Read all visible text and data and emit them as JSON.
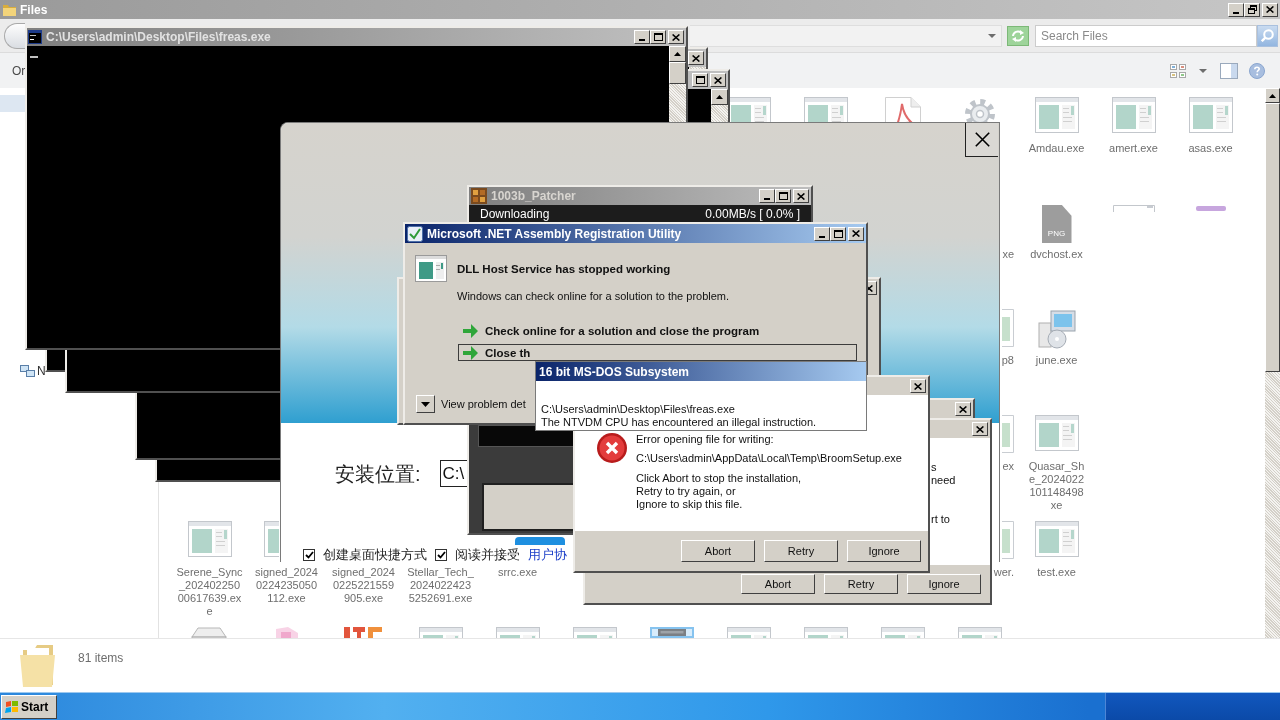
{
  "explorer": {
    "title": "Files",
    "search": {
      "placeholder": "Search Files"
    },
    "command_bar": {
      "organize": "Or"
    },
    "nav_items": [
      {
        "selected": true
      },
      {
        "label": "N",
        "selected": false
      }
    ],
    "files": [
      {
        "kind": "doc",
        "selected": false
      },
      {
        "kind": "doc",
        "selected": false
      },
      {
        "kind": "pdf",
        "selected": false
      },
      {
        "kind": "gear",
        "selected": false
      },
      {
        "kind": "doc",
        "label": "Amdau.exe",
        "selected": false
      },
      {
        "kind": "doc",
        "label": "amert.exe",
        "selected": false
      },
      {
        "kind": "doc",
        "label": "asas.exe",
        "selected": false
      },
      {
        "kind": "tail",
        "label": "xe",
        "selected": false
      },
      {
        "kind": "png",
        "badge": "PNG",
        "label": "dvchost.ex",
        "selected": false
      },
      {
        "kind": "sliver",
        "selected": false
      },
      {
        "kind": "band",
        "selected": false
      },
      {
        "kind": "edge",
        "label": "p8",
        "selected": false
      },
      {
        "kind": "setup",
        "label": "june.exe",
        "selected": false
      },
      {
        "kind": "edge",
        "label": "ex",
        "selected": false
      },
      {
        "kind": "doc",
        "lines": [
          "Quasar_Sh",
          "e_2024022",
          "101148498",
          "xe"
        ],
        "selected": false
      },
      {
        "kind": "doc",
        "label": "Serene_Sync_20240225000617639.exe",
        "selected": false
      },
      {
        "kind": "lead",
        "label": "signed_20240224235050112.exe",
        "selected": false
      },
      {
        "kind": "text",
        "label": "signed_20240225221559905.exe",
        "selected": false
      },
      {
        "kind": "text",
        "label": "Stellar_Tech_20240224235252691.exe",
        "selected": false
      },
      {
        "kind": "text",
        "label": "srrc.exe",
        "selected": false
      },
      {
        "kind": "edge",
        "label": "wer.",
        "selected": false
      },
      {
        "kind": "doc",
        "label": "test.exe",
        "selected": false
      },
      {
        "kind": "printer",
        "selected": false
      },
      {
        "kind": "pink",
        "selected": false
      },
      {
        "kind": "red",
        "selected": false
      },
      {
        "kind": "doc",
        "selected": false
      },
      {
        "kind": "doc",
        "selected": false
      },
      {
        "kind": "doc",
        "selected": false
      },
      {
        "kind": "dark",
        "selected": true
      },
      {
        "kind": "doc",
        "selected": false
      },
      {
        "kind": "doc",
        "selected": false
      },
      {
        "kind": "doc",
        "selected": false
      },
      {
        "kind": "doc",
        "selected": false
      }
    ],
    "status": "81 items"
  },
  "console": {
    "title": "C:\\Users\\admin\\Desktop\\Files\\freas.exe"
  },
  "installer": {
    "location_label": "安装位置:",
    "location_value": "C:\\",
    "options": [
      {
        "label": "创建桌面快捷方式",
        "checked": true
      },
      {
        "label": "阅读并接受",
        "checked": true
      }
    ],
    "agreement_link": "用户协"
  },
  "patcher": {
    "title": "1003b_Patcher",
    "status": "Downloading",
    "speed": "0.00MB/s [ 0.0% ]"
  },
  "net_dialog": {
    "title": "Microsoft .NET Assembly Registration Utility",
    "heading": "DLL Host Service has stopped working",
    "message": "Windows can check online for a solution to the problem.",
    "options": [
      {
        "label": "Check online for a solution and close the program",
        "selected": false
      },
      {
        "label": "Close th",
        "selected": true
      }
    ],
    "details": "View problem det"
  },
  "dos_dialog": {
    "title": "16 bit MS-DOS Subsystem",
    "lines": [
      "C:\\Users\\admin\\Desktop\\Files\\freas.exe",
      "The NTVDM CPU has encountered an illegal instruction."
    ]
  },
  "error_dialog": {
    "lines": [
      "Error opening file for writing:",
      "C:\\Users\\admin\\AppData\\Local\\Temp\\BroomSetup.exe",
      "Click Abort to stop the installation,",
      "Retry to try again, or",
      "Ignore to skip this file."
    ],
    "buttons": [
      "Abort",
      "Retry",
      "Ignore"
    ]
  },
  "error_dialog_behind": {
    "fragments": [
      "s",
      "need",
      "rt to"
    ],
    "buttons": [
      "Abort",
      "Retry",
      "Ignore"
    ]
  },
  "taskbar": {
    "start": "Start"
  }
}
